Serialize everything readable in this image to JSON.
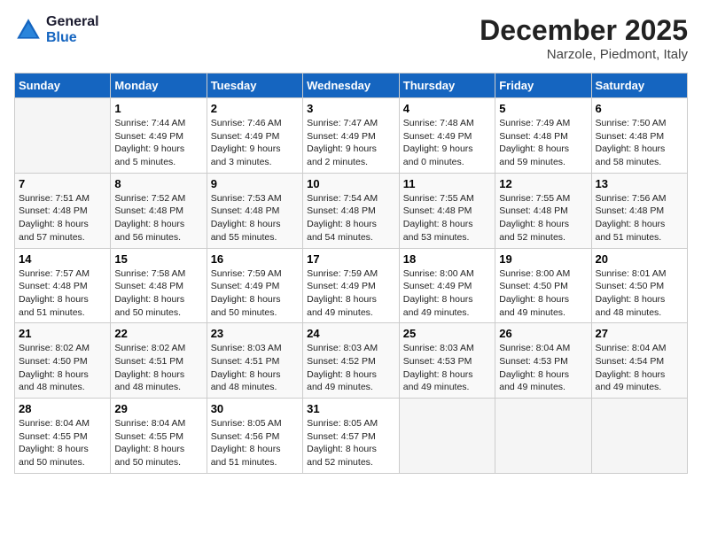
{
  "logo": {
    "line1": "General",
    "line2": "Blue"
  },
  "title": "December 2025",
  "subtitle": "Narzole, Piedmont, Italy",
  "days_header": [
    "Sunday",
    "Monday",
    "Tuesday",
    "Wednesday",
    "Thursday",
    "Friday",
    "Saturday"
  ],
  "weeks": [
    [
      {
        "day": "",
        "info": ""
      },
      {
        "day": "1",
        "info": "Sunrise: 7:44 AM\nSunset: 4:49 PM\nDaylight: 9 hours\nand 5 minutes."
      },
      {
        "day": "2",
        "info": "Sunrise: 7:46 AM\nSunset: 4:49 PM\nDaylight: 9 hours\nand 3 minutes."
      },
      {
        "day": "3",
        "info": "Sunrise: 7:47 AM\nSunset: 4:49 PM\nDaylight: 9 hours\nand 2 minutes."
      },
      {
        "day": "4",
        "info": "Sunrise: 7:48 AM\nSunset: 4:49 PM\nDaylight: 9 hours\nand 0 minutes."
      },
      {
        "day": "5",
        "info": "Sunrise: 7:49 AM\nSunset: 4:48 PM\nDaylight: 8 hours\nand 59 minutes."
      },
      {
        "day": "6",
        "info": "Sunrise: 7:50 AM\nSunset: 4:48 PM\nDaylight: 8 hours\nand 58 minutes."
      }
    ],
    [
      {
        "day": "7",
        "info": "Sunrise: 7:51 AM\nSunset: 4:48 PM\nDaylight: 8 hours\nand 57 minutes."
      },
      {
        "day": "8",
        "info": "Sunrise: 7:52 AM\nSunset: 4:48 PM\nDaylight: 8 hours\nand 56 minutes."
      },
      {
        "day": "9",
        "info": "Sunrise: 7:53 AM\nSunset: 4:48 PM\nDaylight: 8 hours\nand 55 minutes."
      },
      {
        "day": "10",
        "info": "Sunrise: 7:54 AM\nSunset: 4:48 PM\nDaylight: 8 hours\nand 54 minutes."
      },
      {
        "day": "11",
        "info": "Sunrise: 7:55 AM\nSunset: 4:48 PM\nDaylight: 8 hours\nand 53 minutes."
      },
      {
        "day": "12",
        "info": "Sunrise: 7:55 AM\nSunset: 4:48 PM\nDaylight: 8 hours\nand 52 minutes."
      },
      {
        "day": "13",
        "info": "Sunrise: 7:56 AM\nSunset: 4:48 PM\nDaylight: 8 hours\nand 51 minutes."
      }
    ],
    [
      {
        "day": "14",
        "info": "Sunrise: 7:57 AM\nSunset: 4:48 PM\nDaylight: 8 hours\nand 51 minutes."
      },
      {
        "day": "15",
        "info": "Sunrise: 7:58 AM\nSunset: 4:48 PM\nDaylight: 8 hours\nand 50 minutes."
      },
      {
        "day": "16",
        "info": "Sunrise: 7:59 AM\nSunset: 4:49 PM\nDaylight: 8 hours\nand 50 minutes."
      },
      {
        "day": "17",
        "info": "Sunrise: 7:59 AM\nSunset: 4:49 PM\nDaylight: 8 hours\nand 49 minutes."
      },
      {
        "day": "18",
        "info": "Sunrise: 8:00 AM\nSunset: 4:49 PM\nDaylight: 8 hours\nand 49 minutes."
      },
      {
        "day": "19",
        "info": "Sunrise: 8:00 AM\nSunset: 4:50 PM\nDaylight: 8 hours\nand 49 minutes."
      },
      {
        "day": "20",
        "info": "Sunrise: 8:01 AM\nSunset: 4:50 PM\nDaylight: 8 hours\nand 48 minutes."
      }
    ],
    [
      {
        "day": "21",
        "info": "Sunrise: 8:02 AM\nSunset: 4:50 PM\nDaylight: 8 hours\nand 48 minutes."
      },
      {
        "day": "22",
        "info": "Sunrise: 8:02 AM\nSunset: 4:51 PM\nDaylight: 8 hours\nand 48 minutes."
      },
      {
        "day": "23",
        "info": "Sunrise: 8:03 AM\nSunset: 4:51 PM\nDaylight: 8 hours\nand 48 minutes."
      },
      {
        "day": "24",
        "info": "Sunrise: 8:03 AM\nSunset: 4:52 PM\nDaylight: 8 hours\nand 49 minutes."
      },
      {
        "day": "25",
        "info": "Sunrise: 8:03 AM\nSunset: 4:53 PM\nDaylight: 8 hours\nand 49 minutes."
      },
      {
        "day": "26",
        "info": "Sunrise: 8:04 AM\nSunset: 4:53 PM\nDaylight: 8 hours\nand 49 minutes."
      },
      {
        "day": "27",
        "info": "Sunrise: 8:04 AM\nSunset: 4:54 PM\nDaylight: 8 hours\nand 49 minutes."
      }
    ],
    [
      {
        "day": "28",
        "info": "Sunrise: 8:04 AM\nSunset: 4:55 PM\nDaylight: 8 hours\nand 50 minutes."
      },
      {
        "day": "29",
        "info": "Sunrise: 8:04 AM\nSunset: 4:55 PM\nDaylight: 8 hours\nand 50 minutes."
      },
      {
        "day": "30",
        "info": "Sunrise: 8:05 AM\nSunset: 4:56 PM\nDaylight: 8 hours\nand 51 minutes."
      },
      {
        "day": "31",
        "info": "Sunrise: 8:05 AM\nSunset: 4:57 PM\nDaylight: 8 hours\nand 52 minutes."
      },
      {
        "day": "",
        "info": ""
      },
      {
        "day": "",
        "info": ""
      },
      {
        "day": "",
        "info": ""
      }
    ]
  ]
}
